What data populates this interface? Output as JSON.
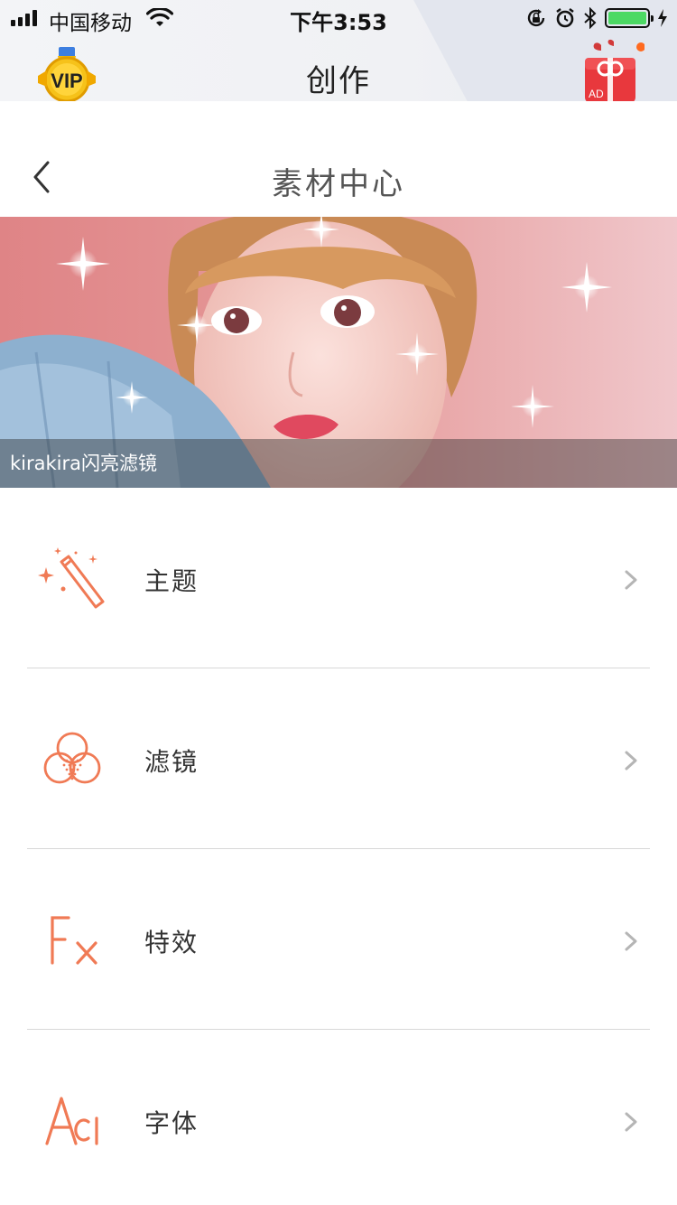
{
  "status_bar": {
    "carrier": "中国移动",
    "time": "下午3:53",
    "battery_level": 1.0
  },
  "app_header": {
    "vip_badge": "VIP",
    "title": "创作",
    "gift_badge": "AD"
  },
  "nav": {
    "title": "素材中心"
  },
  "banner": {
    "caption": "kirakira闪亮滤镜"
  },
  "menu": {
    "items": [
      {
        "label": "主题",
        "icon": "magic-wand-icon"
      },
      {
        "label": "滤镜",
        "icon": "filter-circles-icon"
      },
      {
        "label": "特效",
        "icon": "fx-icon"
      },
      {
        "label": "字体",
        "icon": "font-aa-icon"
      }
    ]
  },
  "colors": {
    "accent": "#f07a55",
    "battery": "#4cd964",
    "divider": "#d8d8d8"
  }
}
